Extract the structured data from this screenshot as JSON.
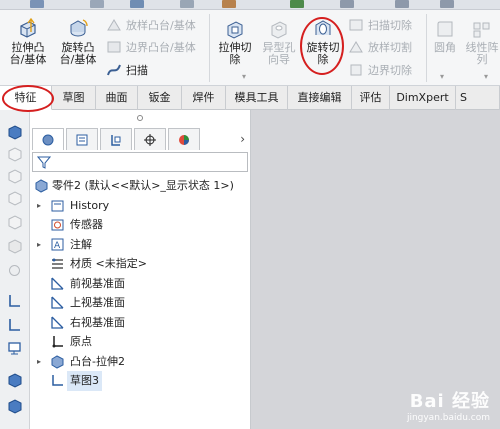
{
  "ribbon": {
    "extrude_boss": "拉伸凸\n台/基体",
    "revolve_boss": "旋转凸\n台/基体",
    "sweep_boss": "放样凸台/基体",
    "boundary_boss": "边界凸台/基体",
    "sweep": "扫描",
    "extrude_cut": "拉伸切\n除",
    "hole_wizard": "异型孔\n向导",
    "revolve_cut": "旋转切\n除",
    "swept_cut": "扫描切除",
    "lofted_cut": "放样切割",
    "boundary_cut": "边界切除",
    "fillet": "圆角",
    "linear_pattern": "线性阵\n列"
  },
  "tabs": [
    "特征",
    "草图",
    "曲面",
    "钣金",
    "焊件",
    "模具工具",
    "直接编辑",
    "评估",
    "DimXpert",
    "S"
  ],
  "active_tab": "特征",
  "tree": {
    "root": "零件2  (默认<<默认>_显示状态 1>)",
    "items": [
      {
        "label": "History",
        "expandable": true
      },
      {
        "label": "传感器",
        "expandable": false
      },
      {
        "label": "注解",
        "expandable": true
      },
      {
        "label": "材质 <未指定>",
        "expandable": false
      },
      {
        "label": "前视基准面",
        "expandable": false
      },
      {
        "label": "上视基准面",
        "expandable": false
      },
      {
        "label": "右视基准面",
        "expandable": false
      },
      {
        "label": "原点",
        "expandable": false
      },
      {
        "label": "凸台-拉伸2",
        "expandable": true
      },
      {
        "label": "草图3",
        "expandable": false,
        "selected": true
      }
    ]
  },
  "watermark": {
    "brand": "Bai 经验",
    "url": "jingyan.baidu.com"
  },
  "colors": {
    "accent": "#d51f1f",
    "selection": "#dbe8f7",
    "gfx_bg": "#d4d5d9"
  }
}
